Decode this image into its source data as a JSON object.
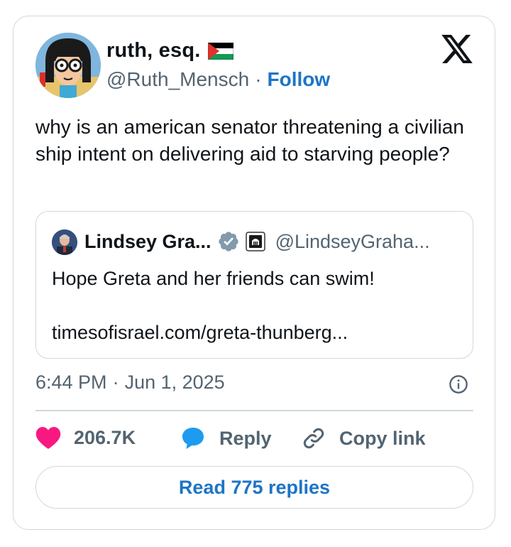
{
  "author": {
    "display_name": "ruth, esq.",
    "handle": "@Ruth_Mensch",
    "separator": "·",
    "follow_label": "Follow",
    "flag_icon": "palestine-flag-icon"
  },
  "tweet": {
    "text": "why is an american senator threatening a civilian ship intent on delivering aid to starving people?",
    "time": "6:44 PM",
    "separator": "·",
    "date": "Jun 1, 2025"
  },
  "quoted": {
    "display_name": "Lindsey Gra...",
    "handle": "@LindseyGraha...",
    "text": "Hope Greta and her friends can swim!",
    "link": "timesofisrael.com/greta-thunberg..."
  },
  "actions": {
    "like_count": "206.7K",
    "reply_label": "Reply",
    "copy_label": "Copy link"
  },
  "read_replies_label": "Read 775 replies",
  "colors": {
    "accent": "#1d75c5",
    "like": "#f91880",
    "reply_icon": "#1d9bf0",
    "muted": "#536471",
    "border": "#cfd9de"
  }
}
